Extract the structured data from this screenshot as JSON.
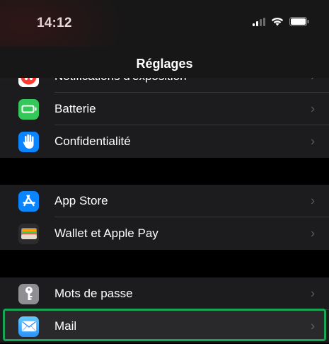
{
  "status_bar": {
    "time": "14:12"
  },
  "nav": {
    "title": "Réglages"
  },
  "groups": [
    {
      "items": [
        {
          "label": "Notifications d'exposition",
          "icon": "exposure-notification-icon",
          "color": "#ffffff"
        },
        {
          "label": "Batterie",
          "icon": "battery-icon",
          "color": "#34c759"
        },
        {
          "label": "Confidentialité",
          "icon": "hand-icon",
          "color": "#0a84ff"
        }
      ]
    },
    {
      "items": [
        {
          "label": "App Store",
          "icon": "app-store-icon",
          "color": "#0a84ff"
        },
        {
          "label": "Wallet et Apple Pay",
          "icon": "wallet-icon",
          "color": "#2c2c2e"
        }
      ]
    },
    {
      "items": [
        {
          "label": "Mots de passe",
          "icon": "key-icon",
          "color": "#8e8e93"
        },
        {
          "label": "Mail",
          "icon": "mail-icon",
          "color": "#1a8cff"
        }
      ]
    }
  ],
  "colors": {
    "background": "#000000",
    "group_background": "#1c1c1e",
    "highlight": "#19a556"
  }
}
